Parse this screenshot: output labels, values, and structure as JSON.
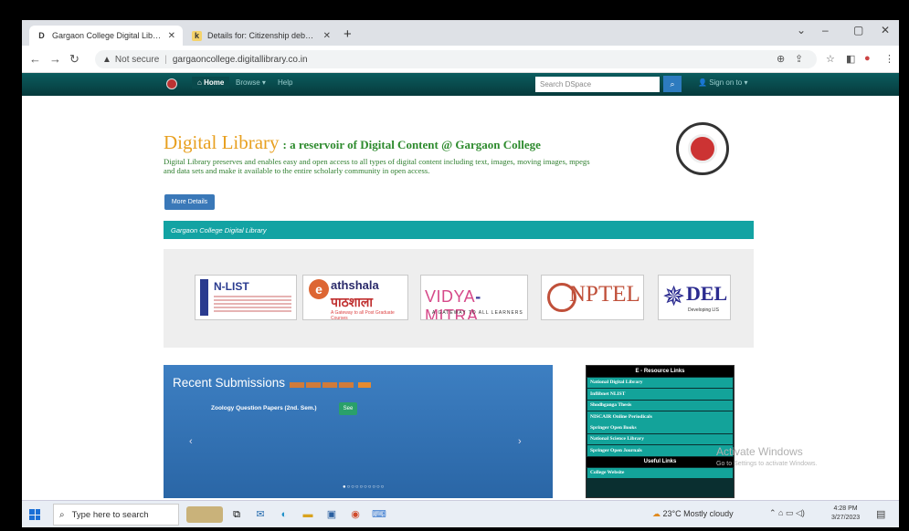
{
  "browser": {
    "tabs": [
      {
        "icon": "D",
        "title": "Gargaon College Digital Library"
      },
      {
        "icon": "k",
        "title": "Details for: Citizenship debate o..."
      }
    ],
    "url_warning": "Not secure",
    "url": "gargaoncollege.digitallibrary.co.in"
  },
  "site_nav": {
    "home": "Home",
    "browse": "Browse",
    "help": "Help",
    "search_placeholder": "Search DSpace",
    "sign_in": "Sign on to"
  },
  "hero": {
    "title_big": "Digital Library",
    "title_small": ": a reservoir of Digital Content @ Gargaon College",
    "description": "Digital Library preserves and enables easy and open access to all types of digital content including text, images, moving images, mpegs and data sets and make it available to the entire scholarly community in open access.",
    "more_button": "More Details"
  },
  "section_bar": "Gargaon College Digital Library",
  "logos": {
    "nlist": "N-LIST",
    "pathshala": "athshala",
    "pathshala_hindi": "पाठशाला",
    "pathshala_sub": "A Gateway to all Post Graduate Courses",
    "vidya_a": "VIDYA",
    "vidya_b": "MITRA",
    "vidya_sub": "A GATEWAY TO ALL LEARNERS",
    "nptel": "NPTEL",
    "del": "DEL",
    "del_sub": "Developing LIS"
  },
  "recent": {
    "title": "Recent Submissions",
    "item": "Zoology Question Papers (2nd. Sem.)",
    "see": "See",
    "dots": "●○○○○○○○○○"
  },
  "eresources": {
    "title": "E - Resource Links",
    "links": [
      "National Digital Library",
      "Inflibnet NLIST",
      "Shodhganga Thesis",
      "NISCAIR Online Periodicals",
      "Springer Open Books",
      "National Science Library",
      "Springer Open Journals"
    ],
    "useful_title": "Useful Links",
    "useful_links": [
      "College Website"
    ]
  },
  "watermark": {
    "line1": "Activate Windows",
    "line2": "Go to Settings to activate Windows."
  },
  "taskbar": {
    "search_placeholder": "Type here to search",
    "weather": "23°C  Mostly cloudy",
    "time": "4:28 PM",
    "date": "3/27/2023"
  }
}
